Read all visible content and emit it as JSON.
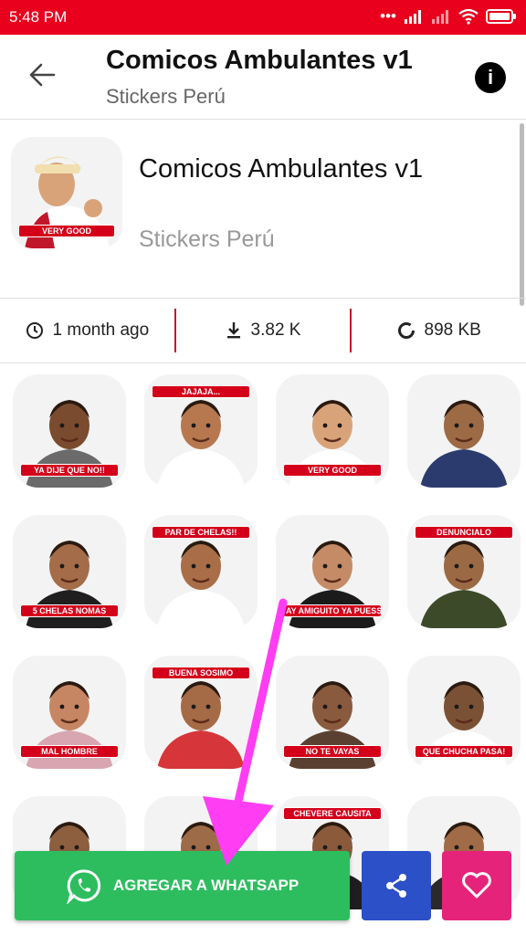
{
  "status": {
    "time": "5:48 PM"
  },
  "appbar": {
    "title": "Comicos Ambulantes v1",
    "subtitle": "Stickers Perú"
  },
  "pack": {
    "title": "Comicos Ambulantes v1",
    "author": "Stickers Perú",
    "thumb_caption": "VERY GOOD"
  },
  "stats": {
    "updated": "1 month ago",
    "downloads": "3.82 K",
    "size": "898 KB"
  },
  "stickers": [
    {
      "caption": "YA DIJE QUE NO!!",
      "skin": "#7a4b2e",
      "shirt": "#6b6b6b"
    },
    {
      "caption": "JAJAJA...",
      "skin": "#b7784f",
      "shirt": "#ffffff"
    },
    {
      "caption": "VERY GOOD",
      "skin": "#d9a37a",
      "shirt": "#ffffff"
    },
    {
      "caption": "",
      "skin": "#9c6a45",
      "shirt": "#2b3b6e"
    },
    {
      "caption": "5 CHELAS NOMAS",
      "skin": "#a46c48",
      "shirt": "#1f1f1f"
    },
    {
      "caption": "PAR DE CHELAS!!",
      "skin": "#a96e47",
      "shirt": "#ffffff"
    },
    {
      "caption": "AY AMIGUITO YA PUESSSS",
      "skin": "#c58b66",
      "shirt": "#1b1b1b"
    },
    {
      "caption": "DENUNCIALO",
      "skin": "#9b6a44",
      "shirt": "#3c4a2a"
    },
    {
      "caption": "MAL HOMBRE",
      "skin": "#c78663",
      "shirt": "#d8a6b0"
    },
    {
      "caption": "BUENA SOSIMO",
      "skin": "#a56a46",
      "shirt": "#d6363a"
    },
    {
      "caption": "NO TE VAYAS",
      "skin": "#8a5a3e",
      "shirt": "#5a4030"
    },
    {
      "caption": "QUE CHUCHA PASA!",
      "skin": "#7b5136",
      "shirt": "#ffffff"
    },
    {
      "caption": "",
      "skin": "#8d5f3f",
      "shirt": "#ffffff"
    },
    {
      "caption": "",
      "skin": "#9e6b48",
      "shirt": "#444444"
    },
    {
      "caption": "CHEVERE CAUSITA",
      "skin": "#8a5a3a",
      "shirt": "#1e1e1e"
    },
    {
      "caption": "",
      "skin": "#a06b46",
      "shirt": "#2a2a2a"
    }
  ],
  "actions": {
    "add_whatsapp": "AGREGAR A WHATSAPP"
  },
  "colors": {
    "statusbar": "#e8001c",
    "whatsapp": "#2dbd5f",
    "share": "#2b50c8",
    "favorite": "#e6237a",
    "annotation_arrow": "#ff3df2"
  }
}
